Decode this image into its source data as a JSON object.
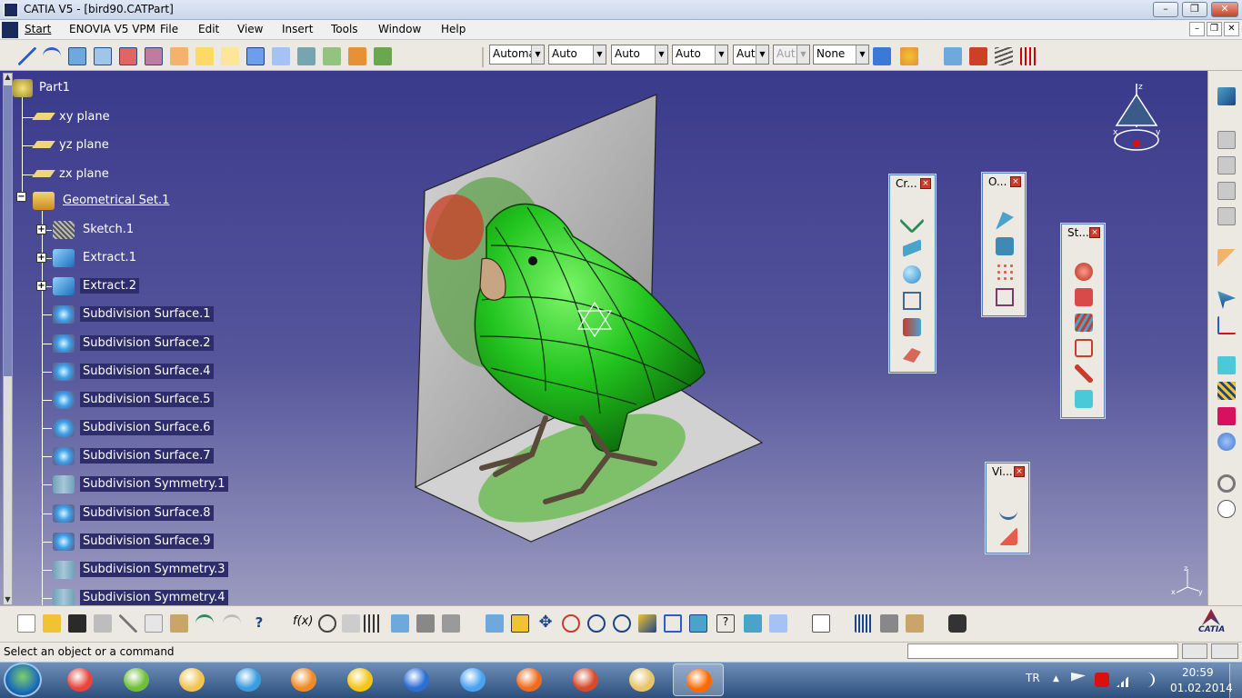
{
  "window": {
    "title": "CATIA V5 - [bird90.CATPart]"
  },
  "window_controls": {
    "minimize": "–",
    "restore": "❐",
    "close": "✕"
  },
  "doc_controls": {
    "minimize": "–",
    "restore": "❐",
    "close": "✕"
  },
  "menu": {
    "start": "Start",
    "enovia": "ENOVIA V5 VPM",
    "file": "File",
    "edit": "Edit",
    "view": "View",
    "insert": "Insert",
    "tools": "Tools",
    "window": "Window",
    "help": "Help"
  },
  "graphic_properties": {
    "color": "Automa",
    "transparency": "Auto",
    "line_thickness": "Auto",
    "linetype": "Auto",
    "point_type": "Aut",
    "layer_disabled": "Aut",
    "layer": "None"
  },
  "tree": {
    "root": "Part1",
    "planes": [
      "xy plane",
      "yz plane",
      "zx plane"
    ],
    "geometrical_set": "Geometrical Set.1",
    "children": [
      {
        "label": "Sketch.1",
        "icon": "sketch-icon",
        "expandable": true,
        "selected": false
      },
      {
        "label": "Extract.1",
        "icon": "extract-icon",
        "expandable": true,
        "selected": false
      },
      {
        "label": "Extract.2",
        "icon": "extract-icon",
        "expandable": true,
        "selected": true
      },
      {
        "label": "Subdivision Surface.1",
        "icon": "subdivision-surface-icon",
        "expandable": false,
        "selected": true
      },
      {
        "label": "Subdivision Surface.2",
        "icon": "subdivision-surface-icon",
        "expandable": false,
        "selected": true
      },
      {
        "label": "Subdivision Surface.4",
        "icon": "subdivision-surface-icon",
        "expandable": false,
        "selected": true
      },
      {
        "label": "Subdivision Surface.5",
        "icon": "subdivision-surface-icon",
        "expandable": false,
        "selected": true
      },
      {
        "label": "Subdivision Surface.6",
        "icon": "subdivision-surface-icon",
        "expandable": false,
        "selected": true
      },
      {
        "label": "Subdivision Surface.7",
        "icon": "subdivision-surface-icon",
        "expandable": false,
        "selected": true
      },
      {
        "label": "Subdivision Symmetry.1",
        "icon": "subdivision-symmetry-icon",
        "expandable": false,
        "selected": true
      },
      {
        "label": "Subdivision Surface.8",
        "icon": "subdivision-surface-icon",
        "expandable": false,
        "selected": true
      },
      {
        "label": "Subdivision Surface.9",
        "icon": "subdivision-surface-icon",
        "expandable": false,
        "selected": true
      },
      {
        "label": "Subdivision Symmetry.3",
        "icon": "subdivision-symmetry-icon",
        "expandable": false,
        "selected": true
      },
      {
        "label": "Subdivision Symmetry.4",
        "icon": "subdivision-symmetry-icon",
        "expandable": false,
        "selected": true
      }
    ]
  },
  "palettes": {
    "creation": {
      "title": "Cr..."
    },
    "operations": {
      "title": "O..."
    },
    "styling": {
      "title": "St..."
    },
    "view": {
      "title": "Vi..."
    }
  },
  "compass_axes": {
    "z": "z",
    "x": "x",
    "y": "y"
  },
  "axis_triad": {
    "z": "z",
    "x": "x",
    "y": "y"
  },
  "status": {
    "message": "Select an object or a command",
    "input_value": ""
  },
  "catia_logo": "CATIA",
  "taskbar": {
    "language": "TR",
    "time": "20:59",
    "date": "01.02.2014",
    "apps": [
      {
        "name": "chrome-icon",
        "color": "#e8453c"
      },
      {
        "name": "utorrent-icon",
        "color": "#6fbf3a"
      },
      {
        "name": "file-explorer-icon",
        "color": "#f3c453"
      },
      {
        "name": "internet-explorer-icon",
        "color": "#3a9de0"
      },
      {
        "name": "media-player-icon",
        "color": "#f08a24"
      },
      {
        "name": "lightning-app-icon",
        "color": "#f5c516"
      },
      {
        "name": "media-center-icon",
        "color": "#2b6fd6"
      },
      {
        "name": "device-sync-icon",
        "color": "#4aa3f0"
      },
      {
        "name": "firefox-like-icon",
        "color": "#f06b1c"
      },
      {
        "name": "ccleaner-icon",
        "color": "#d84a2a"
      },
      {
        "name": "image-viewer-icon",
        "color": "#e8c56a"
      },
      {
        "name": "catia-app-icon",
        "color": "#ff6a00"
      }
    ]
  },
  "colors": {
    "viewport_top": "#3a3a8c",
    "viewport_bottom": "#9b9bc0",
    "bird_body": "#22c41e",
    "tree_selection": "#2c2d6a"
  }
}
